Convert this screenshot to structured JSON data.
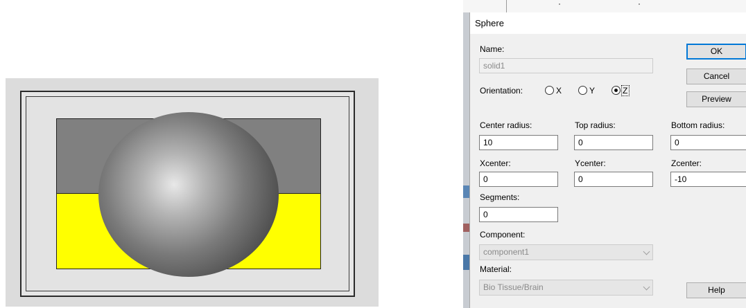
{
  "dialog": {
    "title": "Sphere",
    "name_label": "Name:",
    "name_value": "solid1",
    "orientation_label": "Orientation:",
    "orientation_options": [
      "X",
      "Y",
      "Z"
    ],
    "orientation_selected": "Z",
    "buttons": {
      "ok": "OK",
      "cancel": "Cancel",
      "preview": "Preview",
      "help": "Help"
    },
    "center_radius": {
      "label": "Center radius:",
      "value": "10"
    },
    "top_radius": {
      "label": "Top radius:",
      "value": "0"
    },
    "bottom_radius": {
      "label": "Bottom radius:",
      "value": "0"
    },
    "xcenter": {
      "label": "Xcenter:",
      "value": "0"
    },
    "ycenter": {
      "label": "Ycenter:",
      "value": "0"
    },
    "zcenter": {
      "label": "Zcenter:",
      "value": "-10"
    },
    "segments": {
      "label": "Segments:",
      "value": "0"
    },
    "component": {
      "label": "Component:",
      "value": "component1"
    },
    "material": {
      "label": "Material:",
      "value": "Bio Tissue/Brain"
    }
  },
  "viewport": {
    "colors": {
      "sphere": "#7a7a7a",
      "upper_block": "#808080",
      "lower_block": "#ffff00",
      "background": "#dcdcdc"
    }
  }
}
